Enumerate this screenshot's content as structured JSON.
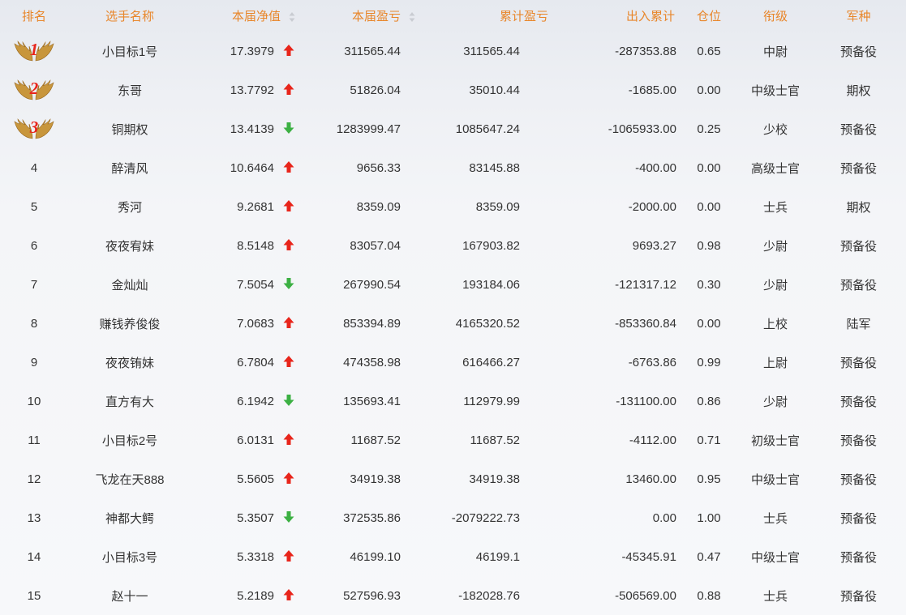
{
  "header": {
    "rank": "排名",
    "name": "选手名称",
    "nav": "本届净值",
    "profit": "本届盈亏",
    "total": "累计盈亏",
    "flow": "出入累计",
    "position": "仓位",
    "title": "衔级",
    "branch": "军种"
  },
  "colors": {
    "header_text": "#e8862a",
    "up": "#e8251b",
    "down": "#3cb043",
    "medal": "#c8963c"
  },
  "rows": [
    {
      "rank": "1",
      "name": "小目标1号",
      "nav": "17.3979",
      "trend": "up",
      "profit": "311565.44",
      "total": "311565.44",
      "flow": "-287353.88",
      "position": "0.65",
      "title": "中尉",
      "branch": "预备役"
    },
    {
      "rank": "2",
      "name": "东哥",
      "nav": "13.7792",
      "trend": "up",
      "profit": "51826.04",
      "total": "35010.44",
      "flow": "-1685.00",
      "position": "0.00",
      "title": "中级士官",
      "branch": "期权"
    },
    {
      "rank": "3",
      "name": "铜期权",
      "nav": "13.4139",
      "trend": "down",
      "profit": "1283999.47",
      "total": "1085647.24",
      "flow": "-1065933.00",
      "position": "0.25",
      "title": "少校",
      "branch": "预备役"
    },
    {
      "rank": "4",
      "name": "醉清风",
      "nav": "10.6464",
      "trend": "up",
      "profit": "9656.33",
      "total": "83145.88",
      "flow": "-400.00",
      "position": "0.00",
      "title": "高级士官",
      "branch": "预备役"
    },
    {
      "rank": "5",
      "name": "秀河",
      "nav": "9.2681",
      "trend": "up",
      "profit": "8359.09",
      "total": "8359.09",
      "flow": "-2000.00",
      "position": "0.00",
      "title": "士兵",
      "branch": "期权"
    },
    {
      "rank": "6",
      "name": "夜夜宥妹",
      "nav": "8.5148",
      "trend": "up",
      "profit": "83057.04",
      "total": "167903.82",
      "flow": "9693.27",
      "position": "0.98",
      "title": "少尉",
      "branch": "预备役"
    },
    {
      "rank": "7",
      "name": "金灿灿",
      "nav": "7.5054",
      "trend": "down",
      "profit": "267990.54",
      "total": "193184.06",
      "flow": "-121317.12",
      "position": "0.30",
      "title": "少尉",
      "branch": "预备役"
    },
    {
      "rank": "8",
      "name": "赚钱养俊俊",
      "nav": "7.0683",
      "trend": "up",
      "profit": "853394.89",
      "total": "4165320.52",
      "flow": "-853360.84",
      "position": "0.00",
      "title": "上校",
      "branch": "陆军"
    },
    {
      "rank": "9",
      "name": "夜夜铕妹",
      "nav": "6.7804",
      "trend": "up",
      "profit": "474358.98",
      "total": "616466.27",
      "flow": "-6763.86",
      "position": "0.99",
      "title": "上尉",
      "branch": "预备役"
    },
    {
      "rank": "10",
      "name": "直方有大",
      "nav": "6.1942",
      "trend": "down",
      "profit": "135693.41",
      "total": "112979.99",
      "flow": "-131100.00",
      "position": "0.86",
      "title": "少尉",
      "branch": "预备役"
    },
    {
      "rank": "11",
      "name": "小目标2号",
      "nav": "6.0131",
      "trend": "up",
      "profit": "11687.52",
      "total": "11687.52",
      "flow": "-4112.00",
      "position": "0.71",
      "title": "初级士官",
      "branch": "预备役"
    },
    {
      "rank": "12",
      "name": "飞龙在天888",
      "nav": "5.5605",
      "trend": "up",
      "profit": "34919.38",
      "total": "34919.38",
      "flow": "13460.00",
      "position": "0.95",
      "title": "中级士官",
      "branch": "预备役"
    },
    {
      "rank": "13",
      "name": "神都大鳄",
      "nav": "5.3507",
      "trend": "down",
      "profit": "372535.86",
      "total": "-2079222.73",
      "flow": "0.00",
      "position": "1.00",
      "title": "士兵",
      "branch": "预备役"
    },
    {
      "rank": "14",
      "name": "小目标3号",
      "nav": "5.3318",
      "trend": "up",
      "profit": "46199.10",
      "total": "46199.1",
      "flow": "-45345.91",
      "position": "0.47",
      "title": "中级士官",
      "branch": "预备役"
    },
    {
      "rank": "15",
      "name": "赵十一",
      "nav": "5.2189",
      "trend": "up",
      "profit": "527596.93",
      "total": "-182028.76",
      "flow": "-506569.00",
      "position": "0.88",
      "title": "士兵",
      "branch": "预备役"
    }
  ]
}
